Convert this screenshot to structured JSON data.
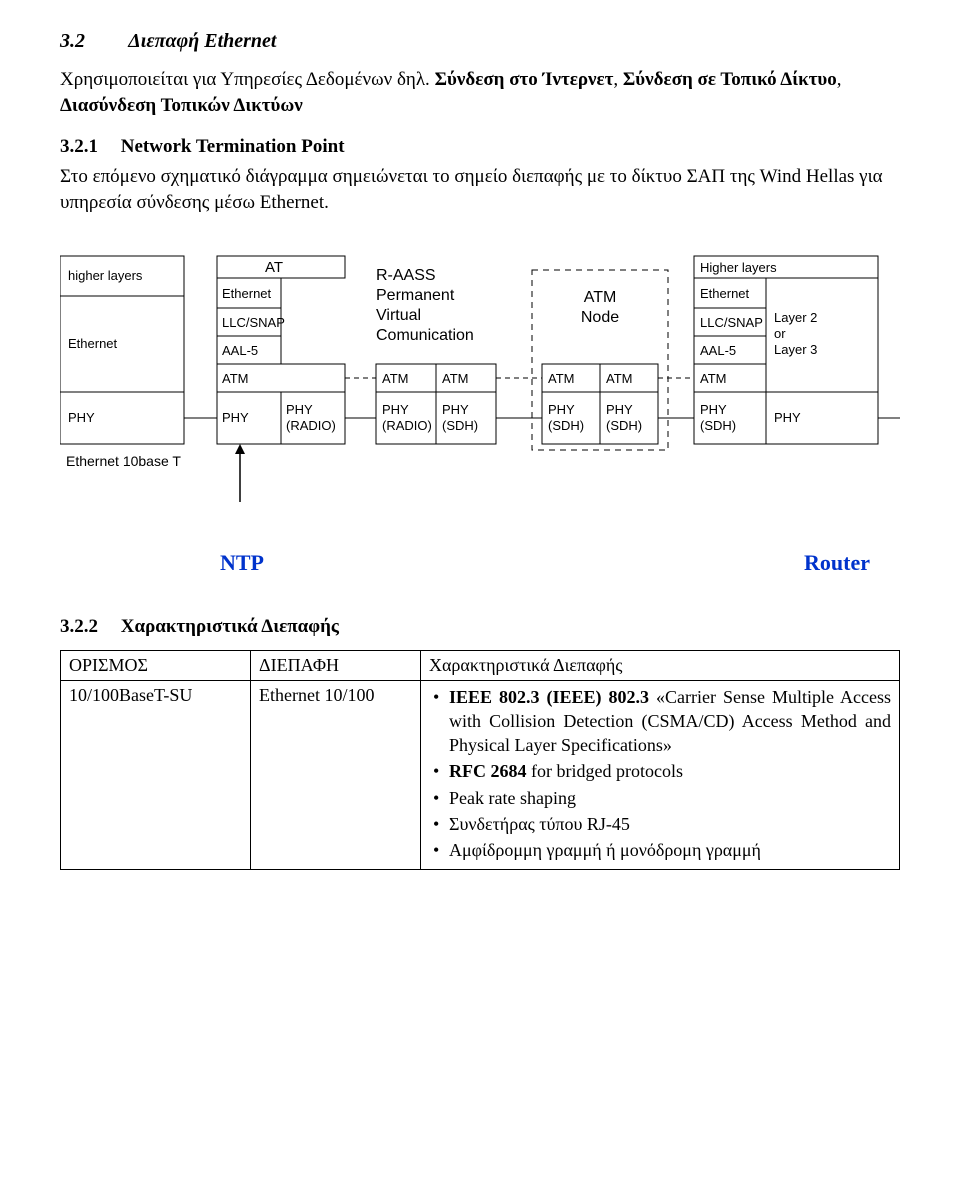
{
  "section3_2": {
    "num": "3.2",
    "title": "Διεπαφή Ethernet",
    "para_lead": "Χρησιμοποιείται για Υπηρεσίες Δεδομένων δηλ. ",
    "para_bold1": "Σύνδεση στο Ίντερνετ",
    "para_sep1": ", ",
    "para_bold2": "Σύνδεση σε Τοπικό Δίκτυο",
    "para_sep2": ", ",
    "para_bold3": "Διασύνδεση Τοπικών Δικτύων"
  },
  "section3_2_1": {
    "num": "3.2.1",
    "title": "Network Termination Point",
    "para": "Στο επόμενο σχηματικό διάγραμμα σημειώνεται το σημείο διεπαφής με το δίκτυο ΣΑΠ της Wind Hellas για υπηρεσία σύνδεσης μέσω Ethernet."
  },
  "diagram": {
    "col1_top": "higher layers",
    "col1_eth": "Ethernet",
    "col1_phy": "PHY",
    "col1_caption": "Ethernet 10base T",
    "col2_top": "AT",
    "col2_r1": "Ethernet",
    "col2_r2": "LLC/SNAP",
    "col2_r3": "AAL-5",
    "col2_r4": "ATM",
    "col2_r5a": "PHY",
    "col2_r5b_l1": "PHY",
    "col2_r5b_l2": "(RADIO)",
    "center_t1": "R-AASS",
    "center_t2": "Permanent",
    "center_t3": "Virtual",
    "center_t4": "Comunication",
    "center_atm_l": "ATM",
    "center_atm_r": "ATM",
    "center_phy_l1": "PHY",
    "center_phy_l2": "(RADIO)",
    "center_phy_r1": "PHY",
    "center_phy_r2": "(SDH)",
    "node_t1": "ATM",
    "node_t2": "Node",
    "node_atm_l": "ATM",
    "node_atm_r": "ATM",
    "node_phy_l1": "PHY",
    "node_phy_l2": "(SDH)",
    "node_phy_r1": "PHY",
    "node_phy_r2": "(SDH)",
    "col5_top": "Higher layers",
    "col5_r1": "Ethernet",
    "col5_r2": "LLC/SNAP",
    "col5_r3": "AAL-5",
    "col5_r4": "ATM",
    "col5_r5_l1": "PHY",
    "col5_r5_l2": "(SDH)",
    "col5b_r1_l1": "Layer 2",
    "col5b_r1_l2": "or",
    "col5b_r1_l3": "Layer 3",
    "col5b_phy": "PHY"
  },
  "labels": {
    "ntp": "NTP",
    "router": "Router"
  },
  "section3_2_2": {
    "num": "3.2.2",
    "title": "Χαρακτηριστικά Διεπαφής"
  },
  "table": {
    "h1": "ΟΡΙΣΜΟΣ",
    "h2": "ΔΙΕΠΑΦΗ",
    "h3": "Χαρακτηριστικά Διεπαφής",
    "c1": "10/100BaseT-SU",
    "c2": "Ethernet 10/100",
    "li1_bold": "IEEE 802.3 (IEEE) 802.3",
    "li1_rest": " «Carrier Sense Multiple Access with Collision Detection (CSMA/CD) Access Method and Physical Layer Specifications»",
    "li2_bold": "RFC 2684",
    "li2_rest": " for bridged protocols",
    "li3": "Peak rate shaping",
    "li4": "Συνδετήρας τύπου RJ-45",
    "li5": "Αμφίδρομμη γραμμή ή μονόδρομη γραμμή"
  }
}
